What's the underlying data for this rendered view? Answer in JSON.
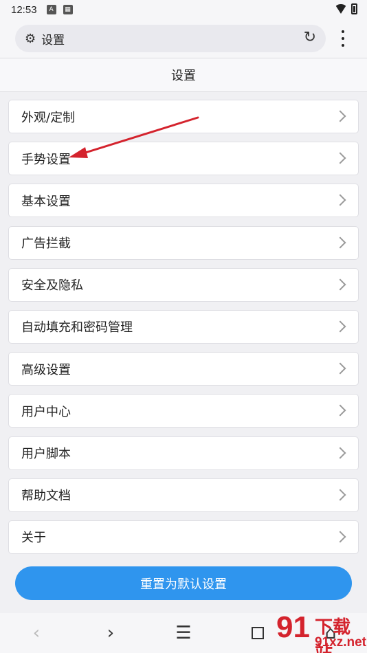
{
  "status_bar": {
    "time": "12:53",
    "icons": [
      "a-icon",
      "rms-icon",
      "wifi-icon",
      "battery-icon"
    ]
  },
  "address_bar": {
    "url_text": "设置",
    "left_icon": "gear-icon",
    "right_icon": "reload-icon"
  },
  "header": {
    "title": "设置"
  },
  "settings": {
    "items": [
      {
        "label": "外观/定制"
      },
      {
        "label": "手势设置"
      },
      {
        "label": "基本设置"
      },
      {
        "label": "广告拦截"
      },
      {
        "label": "安全及隐私"
      },
      {
        "label": "自动填充和密码管理"
      },
      {
        "label": "高级设置"
      },
      {
        "label": "用户中心"
      },
      {
        "label": "用户脚本"
      },
      {
        "label": "帮助文档"
      },
      {
        "label": "关于"
      }
    ]
  },
  "reset_button": {
    "label": "重置为默认设置"
  },
  "bottom_nav": {
    "back": "‹",
    "forward": "›",
    "menu": "☰",
    "home": "⌂"
  },
  "watermark": {
    "number": "91",
    "title": "下载站",
    "site": "91xz.net"
  },
  "colors": {
    "accent": "#2f95ee",
    "arrow": "#d4232d",
    "watermark": "#d4232d"
  }
}
